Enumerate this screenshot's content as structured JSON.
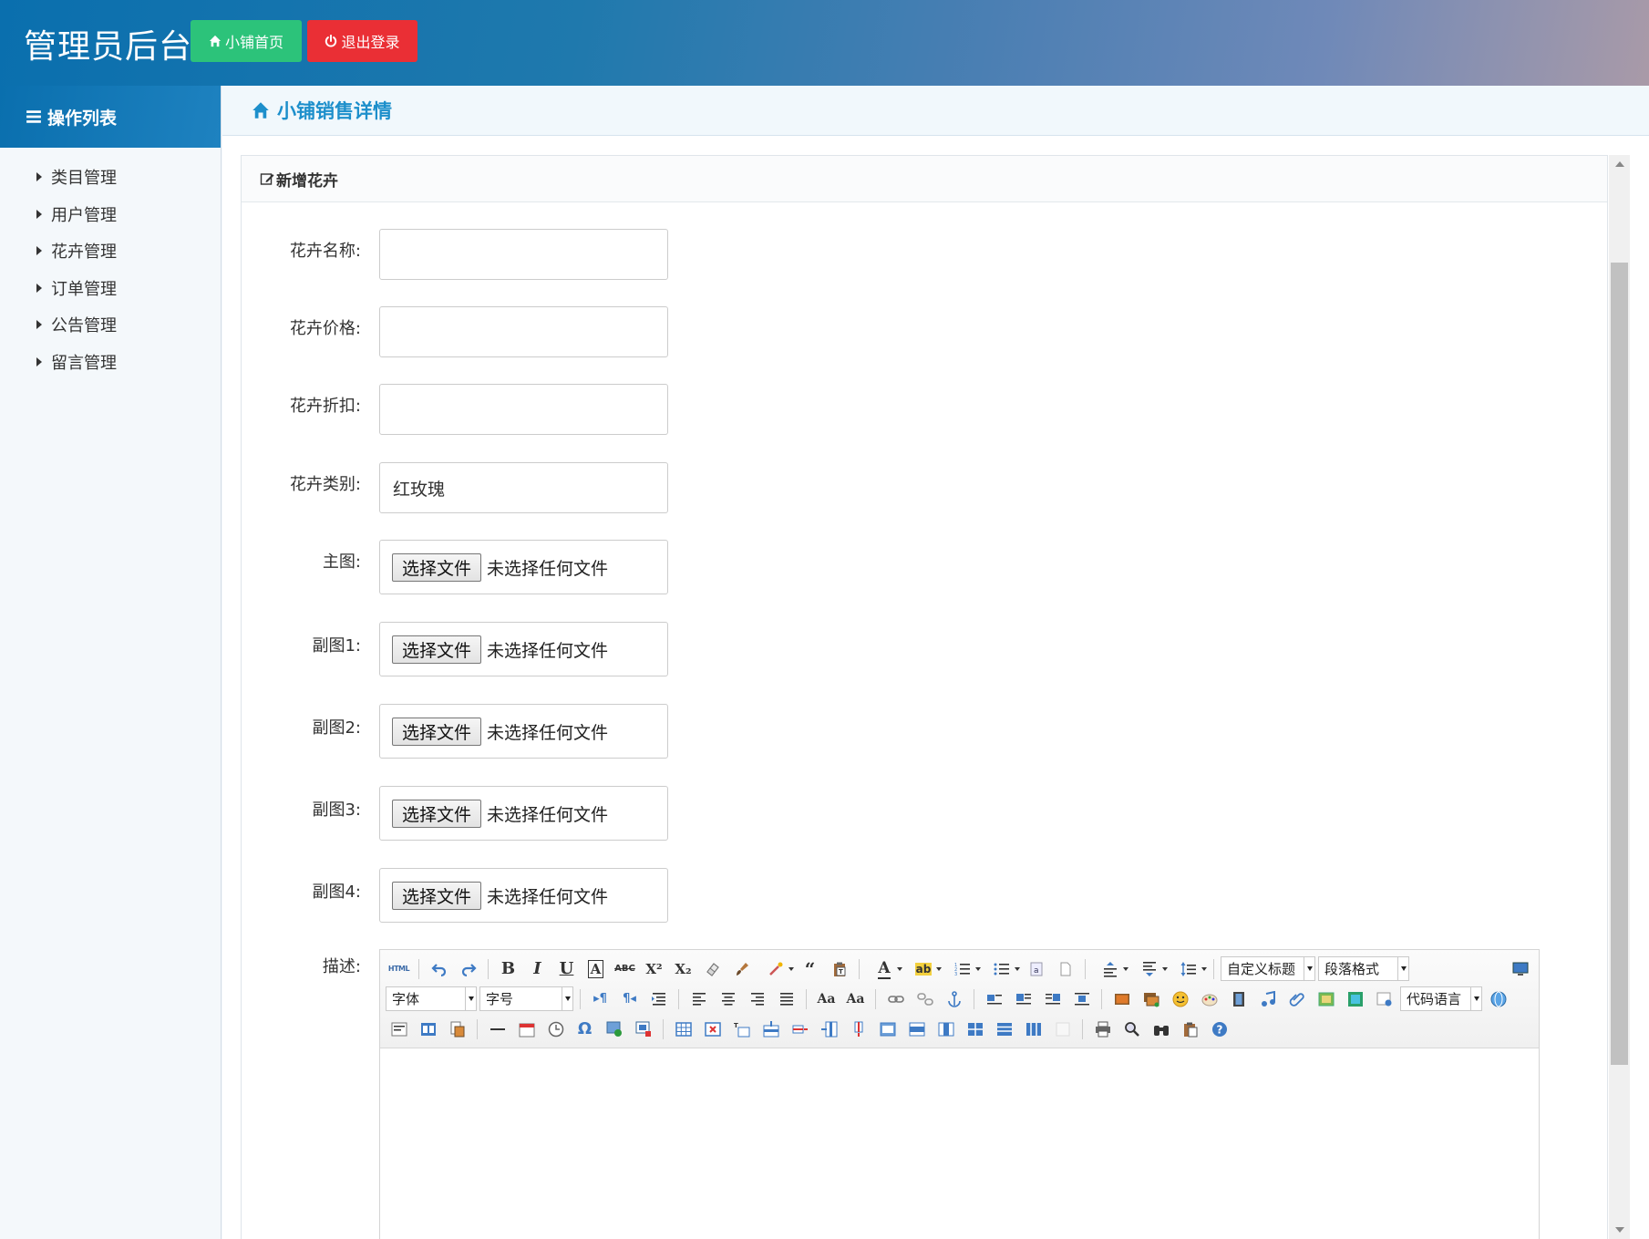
{
  "header": {
    "title": "管理员后台",
    "home_label": "小铺首页",
    "logout_label": "退出登录"
  },
  "sidebar": {
    "title": "操作列表",
    "items": [
      {
        "label": "类目管理"
      },
      {
        "label": "用户管理"
      },
      {
        "label": "花卉管理"
      },
      {
        "label": "订单管理"
      },
      {
        "label": "公告管理"
      },
      {
        "label": "留言管理"
      }
    ]
  },
  "main": {
    "breadcrumb": "小铺销售详情",
    "panel_title": "新增花卉",
    "form": {
      "name_label": "花卉名称:",
      "name_value": "",
      "price_label": "花卉价格:",
      "price_value": "",
      "discount_label": "花卉折扣:",
      "discount_value": "",
      "category_label": "花卉类别:",
      "category_value": "红玫瑰",
      "main_image_label": "主图:",
      "sub1_label": "副图1:",
      "sub2_label": "副图2:",
      "sub3_label": "副图3:",
      "sub4_label": "副图4:",
      "file_button": "选择文件",
      "file_none": "未选择任何文件",
      "desc_label": "描述:"
    },
    "editor": {
      "html_label": "HTML",
      "custom_title": "自定义标题",
      "paragraph_format": "段落格式",
      "font_family": "字体",
      "font_size": "字号",
      "code_language": "代码语言"
    }
  },
  "colors": {
    "header_start": "#0a6fae",
    "home_button": "#2cc37a",
    "logout_button": "#ea2f35",
    "breadcrumb_text": "#1d8fcb"
  }
}
